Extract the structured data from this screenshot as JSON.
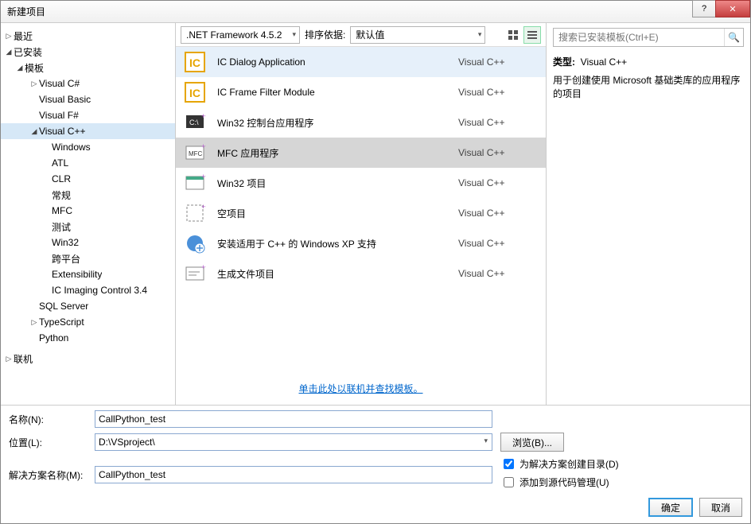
{
  "title": "新建项目",
  "toolbar": {
    "framework": ".NET Framework 4.5.2",
    "sortLabel": "排序依据:",
    "sortValue": "默认值"
  },
  "sidebar": {
    "recent": "最近",
    "installed": "已安装",
    "templates": "模板",
    "online": "联机",
    "cats": [
      {
        "label": "Visual C#",
        "indent": 2,
        "toggle": "▷"
      },
      {
        "label": "Visual Basic",
        "indent": 2,
        "toggle": ""
      },
      {
        "label": "Visual F#",
        "indent": 2,
        "toggle": ""
      },
      {
        "label": "Visual C++",
        "indent": 2,
        "toggle": "◢",
        "sel": true
      },
      {
        "label": "Windows",
        "indent": 3,
        "toggle": ""
      },
      {
        "label": "ATL",
        "indent": 3,
        "toggle": ""
      },
      {
        "label": "CLR",
        "indent": 3,
        "toggle": ""
      },
      {
        "label": "常规",
        "indent": 3,
        "toggle": ""
      },
      {
        "label": "MFC",
        "indent": 3,
        "toggle": ""
      },
      {
        "label": "测试",
        "indent": 3,
        "toggle": ""
      },
      {
        "label": "Win32",
        "indent": 3,
        "toggle": ""
      },
      {
        "label": "跨平台",
        "indent": 3,
        "toggle": ""
      },
      {
        "label": "Extensibility",
        "indent": 3,
        "toggle": ""
      },
      {
        "label": "IC Imaging Control 3.4",
        "indent": 3,
        "toggle": ""
      },
      {
        "label": "SQL Server",
        "indent": 2,
        "toggle": ""
      },
      {
        "label": "TypeScript",
        "indent": 2,
        "toggle": "▷"
      },
      {
        "label": "Python",
        "indent": 2,
        "toggle": ""
      }
    ]
  },
  "templates": [
    {
      "name": "IC Dialog Application",
      "lang": "Visual C++",
      "icon": "ic"
    },
    {
      "name": "IC Frame Filter Module",
      "lang": "Visual C++",
      "icon": "ic"
    },
    {
      "name": "Win32 控制台应用程序",
      "lang": "Visual C++",
      "icon": "console"
    },
    {
      "name": "MFC 应用程序",
      "lang": "Visual C++",
      "icon": "mfc",
      "sel": true
    },
    {
      "name": "Win32 项目",
      "lang": "Visual C++",
      "icon": "win"
    },
    {
      "name": "空项目",
      "lang": "Visual C++",
      "icon": "empty"
    },
    {
      "name": "安装适用于 C++ 的 Windows XP 支持",
      "lang": "Visual C++",
      "icon": "xp"
    },
    {
      "name": "生成文件项目",
      "lang": "Visual C++",
      "icon": "make"
    }
  ],
  "footerLink": "单击此处以联机并查找模板。",
  "search": {
    "placeholder": "搜索已安装模板(Ctrl+E)"
  },
  "detail": {
    "typeLabel": "类型:",
    "typeValue": "Visual C++",
    "desc": "用于创建使用 Microsoft 基础类库的应用程序的项目"
  },
  "form": {
    "nameLabel": "名称(N):",
    "nameValue": "CallPython_test",
    "locLabel": "位置(L):",
    "locValue": "D:\\VSproject\\",
    "browse": "浏览(B)...",
    "solLabel": "解决方案名称(M):",
    "solValue": "CallPython_test",
    "chk1": "为解决方案创建目录(D)",
    "chk2": "添加到源代码管理(U)",
    "ok": "确定",
    "cancel": "取消"
  }
}
